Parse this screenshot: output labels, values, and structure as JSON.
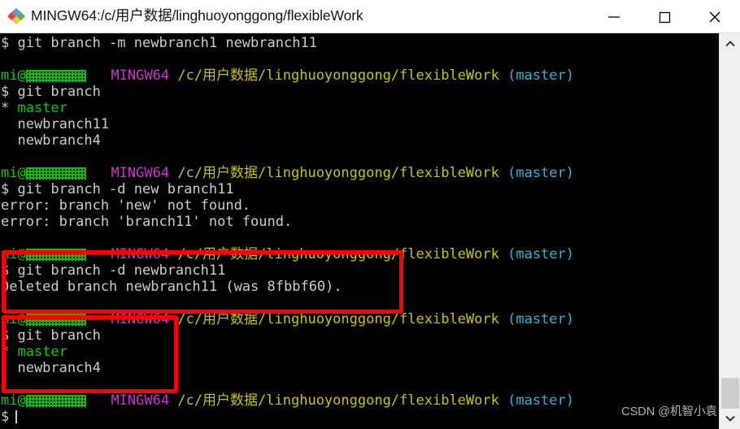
{
  "window": {
    "title": "MINGW64:/c/用户数据/linghuoyonggong/flexibleWork",
    "icon": "mingw-diamond-icon",
    "controls": {
      "minimize": "minimize-icon",
      "maximize": "maximize-icon",
      "close": "close-icon"
    }
  },
  "prompt": {
    "user": "mi@",
    "host_censored": "",
    "shell": "MINGW64",
    "path": "/c/用户数据/linghuoyonggong/flexibleWork",
    "branch": "(master)",
    "sigil": "$"
  },
  "terminal": {
    "lines": [
      {
        "id": "cmd-rename",
        "type": "command",
        "text": "$ git branch -m newbranch1 newbranch11"
      },
      {
        "id": "blank-1",
        "type": "blank",
        "text": " "
      },
      {
        "id": "prompt-1",
        "type": "prompt"
      },
      {
        "id": "cmd-branch-1",
        "type": "command",
        "text": "$ git branch"
      },
      {
        "id": "branch-master-1",
        "type": "branch-current",
        "marker": "*",
        "name": "master"
      },
      {
        "id": "branch-nb11",
        "type": "branch",
        "text": "  newbranch11"
      },
      {
        "id": "branch-nb4-1",
        "type": "branch",
        "text": "  newbranch4"
      },
      {
        "id": "blank-2",
        "type": "blank",
        "text": " "
      },
      {
        "id": "prompt-2",
        "type": "prompt"
      },
      {
        "id": "cmd-delete-bad",
        "type": "command",
        "text": "$ git branch -d new branch11"
      },
      {
        "id": "error-new",
        "type": "output",
        "text": "error: branch 'new' not found."
      },
      {
        "id": "error-branch11",
        "type": "output",
        "text": "error: branch 'branch11' not found."
      },
      {
        "id": "blank-3",
        "type": "blank",
        "text": " "
      },
      {
        "id": "prompt-3",
        "type": "prompt"
      },
      {
        "id": "cmd-delete-good",
        "type": "command",
        "text": "$ git branch -d newbranch11"
      },
      {
        "id": "out-deleted",
        "type": "output",
        "text": "Deleted branch newbranch11 (was 8fbbf60)."
      },
      {
        "id": "blank-4",
        "type": "blank",
        "text": " "
      },
      {
        "id": "prompt-4",
        "type": "prompt"
      },
      {
        "id": "cmd-branch-2",
        "type": "command",
        "text": "$ git branch"
      },
      {
        "id": "branch-master-2",
        "type": "branch-current",
        "marker": "*",
        "name": "master"
      },
      {
        "id": "branch-nb4-2",
        "type": "branch",
        "text": "  newbranch4"
      },
      {
        "id": "blank-5",
        "type": "blank",
        "text": " "
      },
      {
        "id": "prompt-5",
        "type": "prompt"
      },
      {
        "id": "cmd-empty",
        "type": "cursor",
        "text": "$"
      }
    ]
  },
  "annotations": [
    {
      "id": "anno-1",
      "label": "highlight-delete-branch",
      "color": "#ff0000"
    },
    {
      "id": "anno-2",
      "label": "highlight-branch-list",
      "color": "#ff0000"
    }
  ],
  "scrollbar": {
    "up_arrow": "chevron-up-icon",
    "down_arrow": "chevron-down-icon",
    "thumb": "scrollbar-thumb"
  },
  "watermark": {
    "text": "CSDN @机智小袁"
  },
  "colors": {
    "terminal_bg": "#000000",
    "text": "#cccccc",
    "user": "#16c60c",
    "shell": "#d030d0",
    "path": "#c5c500",
    "branch": "#29b8db",
    "annotation": "#ff0000"
  }
}
